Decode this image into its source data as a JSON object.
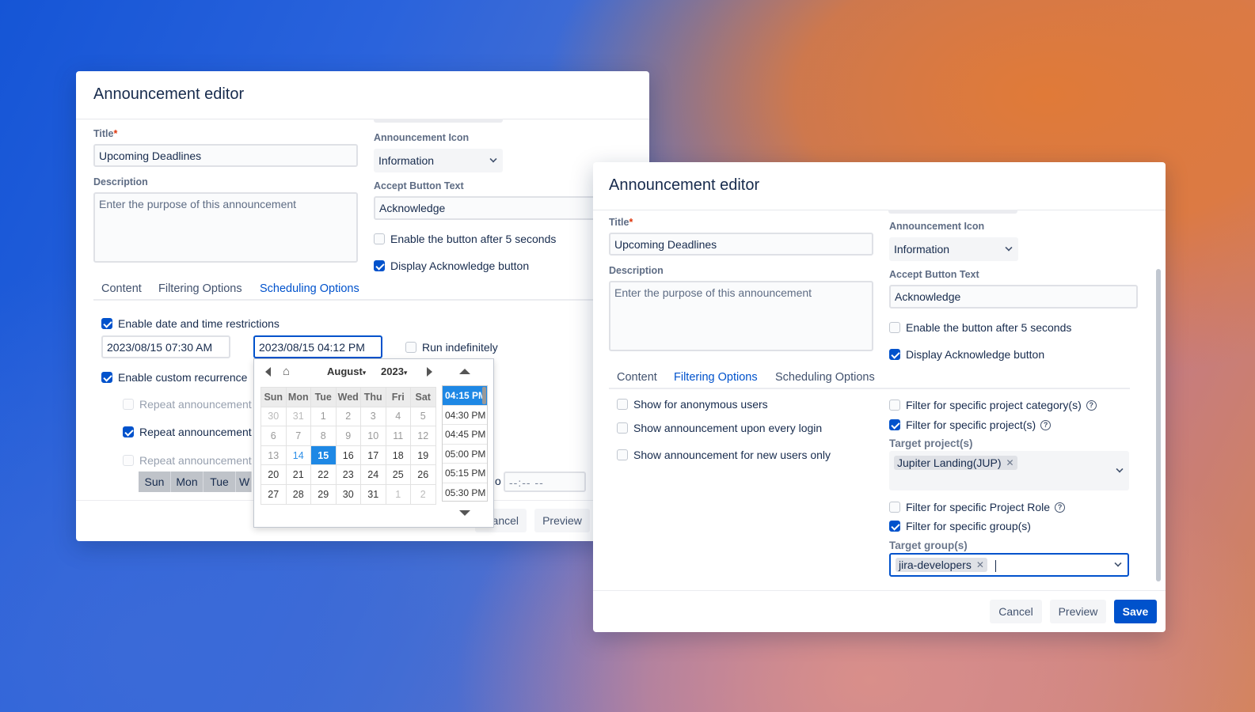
{
  "dialog1": {
    "title": "Announcement editor",
    "title_label": "Title",
    "title_value": "Upcoming Deadlines",
    "description_label": "Description",
    "description_placeholder": "Enter the purpose of this announcement",
    "icon_label": "Announcement Icon",
    "icon_value": "Information",
    "accept_label": "Accept Button Text",
    "accept_value": "Acknowledge",
    "enable_after": "Enable the button after 5 seconds",
    "display_ack": "Display Acknowledge button",
    "tabs": [
      "Content",
      "Filtering Options",
      "Scheduling Options"
    ],
    "enable_date": "Enable date and time restrictions",
    "start_date": "2023/08/15 07:30 AM",
    "end_date": "2023/08/15 04:12 PM",
    "run_indefinitely": "Run indefinitely",
    "enable_recurrence": "Enable custom recurrence",
    "repeat1": "Repeat announcement",
    "repeat2": "Repeat announcement",
    "repeat3": "Repeat announcement",
    "weekdays": [
      "Sun",
      "Mon",
      "Tue",
      "W"
    ],
    "to_label": "o",
    "time_placeholder": "--:-- --",
    "cancel": "ancel",
    "preview": "Preview"
  },
  "calendar": {
    "month": "August",
    "year": "2023",
    "headers": [
      "Sun",
      "Mon",
      "Tue",
      "Wed",
      "Thu",
      "Fri",
      "Sat"
    ],
    "weeks": [
      [
        "30",
        "31",
        "1",
        "2",
        "3",
        "4",
        "5"
      ],
      [
        "6",
        "7",
        "8",
        "9",
        "10",
        "11",
        "12"
      ],
      [
        "13",
        "14",
        "15",
        "16",
        "17",
        "18",
        "19"
      ],
      [
        "20",
        "21",
        "22",
        "23",
        "24",
        "25",
        "26"
      ],
      [
        "27",
        "28",
        "29",
        "30",
        "31",
        "1",
        "2"
      ]
    ],
    "times": [
      "04:15 PM",
      "04:30 PM",
      "04:45 PM",
      "05:00 PM",
      "05:15 PM",
      "05:30 PM"
    ]
  },
  "dialog2": {
    "title": "Announcement editor",
    "title_label": "Title",
    "title_value": "Upcoming Deadlines",
    "description_label": "Description",
    "description_placeholder": "Enter the purpose of this announcement",
    "icon_label": "Announcement Icon",
    "icon_value": "Information",
    "accept_label": "Accept Button Text",
    "accept_value": "Acknowledge",
    "enable_after": "Enable the button after 5 seconds",
    "display_ack": "Display Acknowledge button",
    "tabs": [
      "Content",
      "Filtering Options",
      "Scheduling Options"
    ],
    "anon": "Show for anonymous users",
    "every_login": "Show announcement upon every login",
    "new_users": "Show announcement for new users only",
    "filter_category": "Filter for specific project category(s)",
    "filter_project": "Filter for specific project(s)",
    "target_projects_label": "Target project(s)",
    "project_tag": "Jupiter Landing(JUP)",
    "filter_role": "Filter for specific Project Role",
    "filter_group": "Filter for specific group(s)",
    "target_groups_label": "Target group(s)",
    "group_tag": "jira-developers",
    "cancel": "Cancel",
    "preview": "Preview",
    "save": "Save"
  }
}
